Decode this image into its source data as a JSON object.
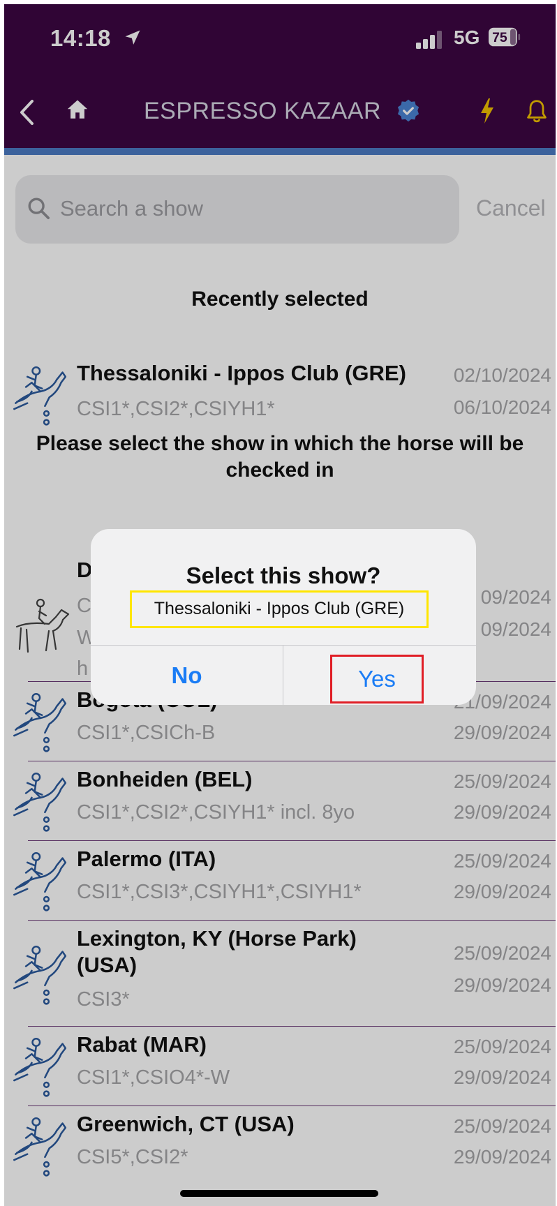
{
  "status_bar": {
    "time": "14:18",
    "network": "5G",
    "battery": "75"
  },
  "header": {
    "title": "ESPRESSO KAZAAR"
  },
  "search": {
    "placeholder": "Search a show",
    "cancel_label": "Cancel"
  },
  "recent": {
    "heading": "Recently selected",
    "items": [
      {
        "name": "Thessaloniki - Ippos Club (GRE)",
        "categories": "CSI1*,CSI2*,CSIYH1*",
        "start": "02/10/2024",
        "end": "06/10/2024"
      }
    ]
  },
  "instruction": "Please select the show in which the horse will be checked in",
  "shows": [
    {
      "name": "D",
      "categories": "C",
      "extra1": "W",
      "extra2": "h",
      "start": "09/2024",
      "end": "09/2024",
      "icon": "dressage-horse-icon"
    },
    {
      "name": "Bogota (COL)",
      "categories": "CSI1*,CSICh-B",
      "start": "21/09/2024",
      "end": "29/09/2024",
      "icon": "jumping-horse-icon"
    },
    {
      "name": "Bonheiden (BEL)",
      "categories": "CSI1*,CSI2*,CSIYH1* incl. 8yo",
      "start": "25/09/2024",
      "end": "29/09/2024",
      "icon": "jumping-horse-icon"
    },
    {
      "name": "Palermo (ITA)",
      "categories": "CSI1*,CSI3*,CSIYH1*,CSIYH1*",
      "start": "25/09/2024",
      "end": "29/09/2024",
      "icon": "jumping-horse-icon"
    },
    {
      "name": "Lexington, KY (Horse Park) (USA)",
      "categories": "CSI3*",
      "start": "25/09/2024",
      "end": "29/09/2024",
      "icon": "jumping-horse-icon"
    },
    {
      "name": "Rabat (MAR)",
      "categories": "CSI1*,CSIO4*-W",
      "start": "25/09/2024",
      "end": "29/09/2024",
      "icon": "jumping-horse-icon"
    },
    {
      "name": "Greenwich, CT (USA)",
      "categories": "CSI5*,CSI2*",
      "start": "25/09/2024",
      "end": "29/09/2024",
      "icon": "jumping-horse-icon"
    }
  ],
  "dialog": {
    "title": "Select this show?",
    "message": "Thessaloniki - Ippos Club (GRE)",
    "no_label": "No",
    "yes_label": "Yes"
  },
  "colors": {
    "header_bg": "#3d0743",
    "accent_bar": "#4b7bc4",
    "ios_blue": "#1a7cf5",
    "bolt": "#f2c200",
    "highlight_yellow": "#ffe600",
    "highlight_red": "#e01e26"
  }
}
